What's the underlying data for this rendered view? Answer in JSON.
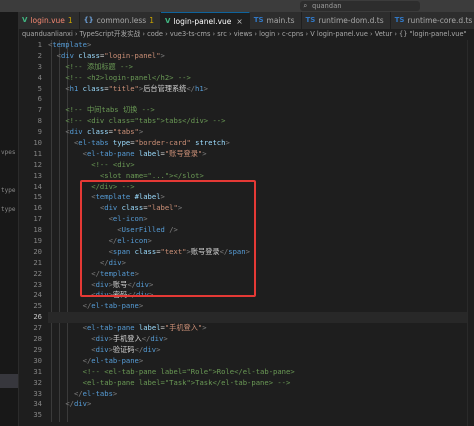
{
  "search": {
    "text": "quandan"
  },
  "activity_items": [
    {
      "label": "",
      "selected": false
    },
    {
      "label": "",
      "selected": false
    },
    {
      "label": "",
      "selected": false
    },
    {
      "label": "",
      "selected": false
    },
    {
      "label": "vpes",
      "selected": false
    },
    {
      "label": "",
      "selected": false
    },
    {
      "label": "type",
      "selected": false
    },
    {
      "label": "type",
      "selected": false
    },
    {
      "label": "",
      "selected": false
    },
    {
      "label": "",
      "selected": false
    },
    {
      "label": "",
      "selected": false
    },
    {
      "label": "",
      "selected": false
    },
    {
      "label": "",
      "selected": false
    },
    {
      "label": "",
      "selected": false
    },
    {
      "label": "",
      "selected": false
    },
    {
      "label": "",
      "selected": false
    },
    {
      "label": "",
      "selected": true
    },
    {
      "label": "",
      "selected": false
    }
  ],
  "tabs": [
    {
      "icon": "V",
      "icon_kind": "vue",
      "label": "login.vue",
      "count": "1",
      "active": false,
      "red": true
    },
    {
      "icon": "{}",
      "icon_kind": "less",
      "label": "common.less",
      "count": "1",
      "active": false,
      "red": false
    },
    {
      "icon": "V",
      "icon_kind": "vue",
      "label": "login-panel.vue",
      "count": "",
      "active": true,
      "red": false,
      "close": "×"
    },
    {
      "icon": "TS",
      "icon_kind": "ts",
      "label": "main.ts",
      "count": "",
      "active": false,
      "red": false
    },
    {
      "icon": "TS",
      "icon_kind": "ts",
      "label": "runtime-dom.d.ts",
      "count": "",
      "active": false,
      "red": false
    },
    {
      "icon": "TS",
      "icon_kind": "ts",
      "label": "runtime-core.d.ts",
      "count": "",
      "active": false,
      "red": false
    }
  ],
  "breadcrumb": "quanduanlianxi › TypeScript开发实战 › code › vue3-ts-cms › src › views › login › c-cpns › V login-panel.vue › Vetur › {} \"login-panel.vue\"",
  "line_numbers": [
    "1",
    "2",
    "3",
    "4",
    "5",
    "6",
    "7",
    "8",
    "9",
    "10",
    "11",
    "12",
    "13",
    "14",
    "15",
    "16",
    "17",
    "18",
    "19",
    "20",
    "21",
    "22",
    "23",
    "24",
    "25",
    "26",
    "27",
    "28",
    "29",
    "30",
    "31",
    "32",
    "33",
    "34",
    "35"
  ],
  "current_line": "26",
  "code_lines": [
    [
      [
        "p",
        "<"
      ],
      [
        "t",
        "template"
      ],
      [
        "p",
        ">"
      ]
    ],
    [
      [
        "x",
        "  "
      ],
      [
        "p",
        "<"
      ],
      [
        "t",
        "div"
      ],
      [
        "x",
        " "
      ],
      [
        "a",
        "class"
      ],
      [
        "x",
        "="
      ],
      [
        "s",
        "\"login-panel\""
      ],
      [
        "p",
        ">"
      ]
    ],
    [
      [
        "x",
        "    "
      ],
      [
        "c",
        "<!-- 添加标题 -->"
      ]
    ],
    [
      [
        "x",
        "    "
      ],
      [
        "c",
        "<!-- <h2>login-panel</h2> -->"
      ]
    ],
    [
      [
        "x",
        "    "
      ],
      [
        "p",
        "<"
      ],
      [
        "t",
        "h1"
      ],
      [
        "x",
        " "
      ],
      [
        "a",
        "class"
      ],
      [
        "x",
        "="
      ],
      [
        "s",
        "\"title\""
      ],
      [
        "p",
        ">"
      ],
      [
        "x",
        "后台管理系统"
      ],
      [
        "p",
        "</"
      ],
      [
        "t",
        "h1"
      ],
      [
        "p",
        ">"
      ]
    ],
    [],
    [
      [
        "x",
        "    "
      ],
      [
        "c",
        "<!-- 中间tabs 切换 -->"
      ]
    ],
    [
      [
        "x",
        "    "
      ],
      [
        "c",
        "<!-- <div class=\"tabs\">tabs</div> -->"
      ]
    ],
    [
      [
        "x",
        "    "
      ],
      [
        "p",
        "<"
      ],
      [
        "t",
        "div"
      ],
      [
        "x",
        " "
      ],
      [
        "a",
        "class"
      ],
      [
        "x",
        "="
      ],
      [
        "s",
        "\"tabs\""
      ],
      [
        "p",
        ">"
      ]
    ],
    [
      [
        "x",
        "      "
      ],
      [
        "p",
        "<"
      ],
      [
        "t",
        "el-tabs"
      ],
      [
        "x",
        " "
      ],
      [
        "a",
        "type"
      ],
      [
        "x",
        "="
      ],
      [
        "s",
        "\"border-card\""
      ],
      [
        "x",
        " "
      ],
      [
        "a",
        "stretch"
      ],
      [
        "p",
        ">"
      ]
    ],
    [
      [
        "x",
        "        "
      ],
      [
        "p",
        "<"
      ],
      [
        "t",
        "el-tab-pane"
      ],
      [
        "x",
        " "
      ],
      [
        "a",
        "label"
      ],
      [
        "x",
        "="
      ],
      [
        "s",
        "\"账号登录\""
      ],
      [
        "p",
        ">"
      ]
    ],
    [
      [
        "x",
        "          "
      ],
      [
        "c",
        "<!-- <div>"
      ]
    ],
    [
      [
        "x",
        "            "
      ],
      [
        "c",
        "<slot name=\"...\"></slot>"
      ]
    ],
    [
      [
        "x",
        "          "
      ],
      [
        "c",
        "</div> -->"
      ]
    ],
    [
      [
        "x",
        "          "
      ],
      [
        "p",
        "<"
      ],
      [
        "t",
        "template"
      ],
      [
        "x",
        " "
      ],
      [
        "a",
        "#label"
      ],
      [
        "p",
        ">"
      ]
    ],
    [
      [
        "x",
        "            "
      ],
      [
        "p",
        "<"
      ],
      [
        "t",
        "div"
      ],
      [
        "x",
        " "
      ],
      [
        "a",
        "class"
      ],
      [
        "x",
        "="
      ],
      [
        "s",
        "\"label\""
      ],
      [
        "p",
        ">"
      ]
    ],
    [
      [
        "x",
        "              "
      ],
      [
        "p",
        "<"
      ],
      [
        "t",
        "el-icon"
      ],
      [
        "p",
        ">"
      ]
    ],
    [
      [
        "x",
        "                "
      ],
      [
        "p",
        "<"
      ],
      [
        "t",
        "UserFilled"
      ],
      [
        "x",
        " "
      ],
      [
        "p",
        "/>"
      ]
    ],
    [
      [
        "x",
        "              "
      ],
      [
        "p",
        "</"
      ],
      [
        "t",
        "el-icon"
      ],
      [
        "p",
        ">"
      ]
    ],
    [
      [
        "x",
        "              "
      ],
      [
        "p",
        "<"
      ],
      [
        "t",
        "span"
      ],
      [
        "x",
        " "
      ],
      [
        "a",
        "class"
      ],
      [
        "x",
        "="
      ],
      [
        "s",
        "\"text\""
      ],
      [
        "p",
        ">"
      ],
      [
        "x",
        "账号登录"
      ],
      [
        "p",
        "</"
      ],
      [
        "t",
        "span"
      ],
      [
        "p",
        ">"
      ]
    ],
    [
      [
        "x",
        "            "
      ],
      [
        "p",
        "</"
      ],
      [
        "t",
        "div"
      ],
      [
        "p",
        ">"
      ]
    ],
    [
      [
        "x",
        "          "
      ],
      [
        "p",
        "</"
      ],
      [
        "t",
        "template"
      ],
      [
        "p",
        ">"
      ]
    ],
    [
      [
        "x",
        "          "
      ],
      [
        "p",
        "<"
      ],
      [
        "t",
        "div"
      ],
      [
        "p",
        ">"
      ],
      [
        "x",
        "账号"
      ],
      [
        "p",
        "</"
      ],
      [
        "t",
        "div"
      ],
      [
        "p",
        ">"
      ]
    ],
    [
      [
        "x",
        "          "
      ],
      [
        "p",
        "<"
      ],
      [
        "t",
        "div"
      ],
      [
        "p",
        ">"
      ],
      [
        "x",
        "密码"
      ],
      [
        "p",
        "</"
      ],
      [
        "t",
        "div"
      ],
      [
        "p",
        ">"
      ]
    ],
    [
      [
        "x",
        "        "
      ],
      [
        "p",
        "</"
      ],
      [
        "t",
        "el-tab-pane"
      ],
      [
        "p",
        ">"
      ]
    ],
    [],
    [
      [
        "x",
        "        "
      ],
      [
        "p",
        "<"
      ],
      [
        "t",
        "el-tab-pane"
      ],
      [
        "x",
        " "
      ],
      [
        "a",
        "label"
      ],
      [
        "x",
        "="
      ],
      [
        "s",
        "\"手机登入\""
      ],
      [
        "p",
        ">"
      ]
    ],
    [
      [
        "x",
        "          "
      ],
      [
        "p",
        "<"
      ],
      [
        "t",
        "div"
      ],
      [
        "p",
        ">"
      ],
      [
        "x",
        "手机登入"
      ],
      [
        "p",
        "</"
      ],
      [
        "t",
        "div"
      ],
      [
        "p",
        ">"
      ]
    ],
    [
      [
        "x",
        "          "
      ],
      [
        "p",
        "<"
      ],
      [
        "t",
        "div"
      ],
      [
        "p",
        ">"
      ],
      [
        "x",
        "验证码"
      ],
      [
        "p",
        "</"
      ],
      [
        "t",
        "div"
      ],
      [
        "p",
        ">"
      ]
    ],
    [
      [
        "x",
        "        "
      ],
      [
        "p",
        "</"
      ],
      [
        "t",
        "el-tab-pane"
      ],
      [
        "p",
        ">"
      ]
    ],
    [
      [
        "x",
        "        "
      ],
      [
        "c",
        "<!-- <el-tab-pane label=\"Role\">Role</el-tab-pane>"
      ]
    ],
    [
      [
        "x",
        "        "
      ],
      [
        "c",
        "<el-tab-pane label=\"Task\">Task</el-tab-pane> -->"
      ]
    ],
    [
      [
        "x",
        "      "
      ],
      [
        "p",
        "</"
      ],
      [
        "t",
        "el-tabs"
      ],
      [
        "p",
        ">"
      ]
    ],
    [
      [
        "x",
        "    "
      ],
      [
        "p",
        "</"
      ],
      [
        "t",
        "div"
      ],
      [
        "p",
        ">"
      ]
    ],
    []
  ],
  "colors": {
    "tag": "#569cd6",
    "attr": "#9cdcfe",
    "string": "#ce9178",
    "comment": "#6a9955",
    "punct": "#808080",
    "highlight_box": "#e53935"
  }
}
